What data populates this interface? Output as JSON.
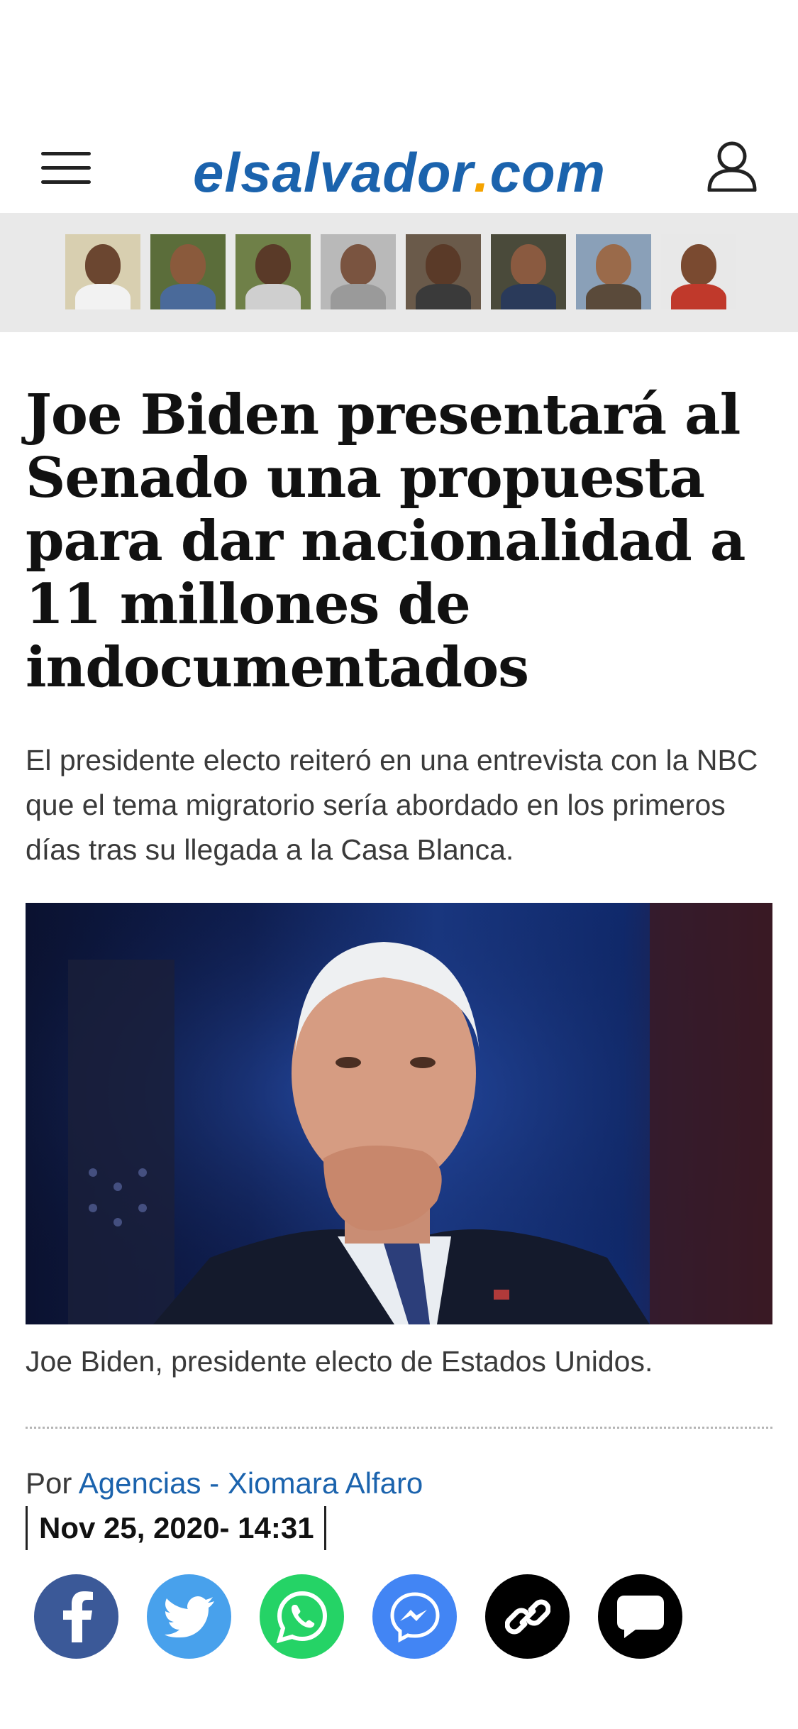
{
  "header": {
    "logo_main": "elsalvador",
    "logo_dot": ".",
    "logo_tld": "com"
  },
  "article": {
    "headline": "Joe Biden presentará al Senado una propuesta para dar nacionalidad a 11 millones de indocumentados",
    "summary": "El presidente electo reiteró en una entrevista con la NBC que el tema migratorio sería abordado en los primeros días tras su llegada a la Casa Blanca.",
    "caption": "Joe Biden, presidente electo de Estados Unidos.",
    "byline_prefix": "Por",
    "authors": "Agencias - Xiomara Alfaro",
    "date": "Nov 25, 2020- 14:31"
  },
  "share": {
    "facebook_color": "#3b5998",
    "twitter_color": "#48a1ec",
    "whatsapp_color": "#25d366",
    "messenger_color": "#4285f4",
    "link_color": "#000000",
    "comment_color": "#000000"
  },
  "colors": {
    "brand_blue": "#1b63ad",
    "brand_orange": "#f5a300"
  }
}
